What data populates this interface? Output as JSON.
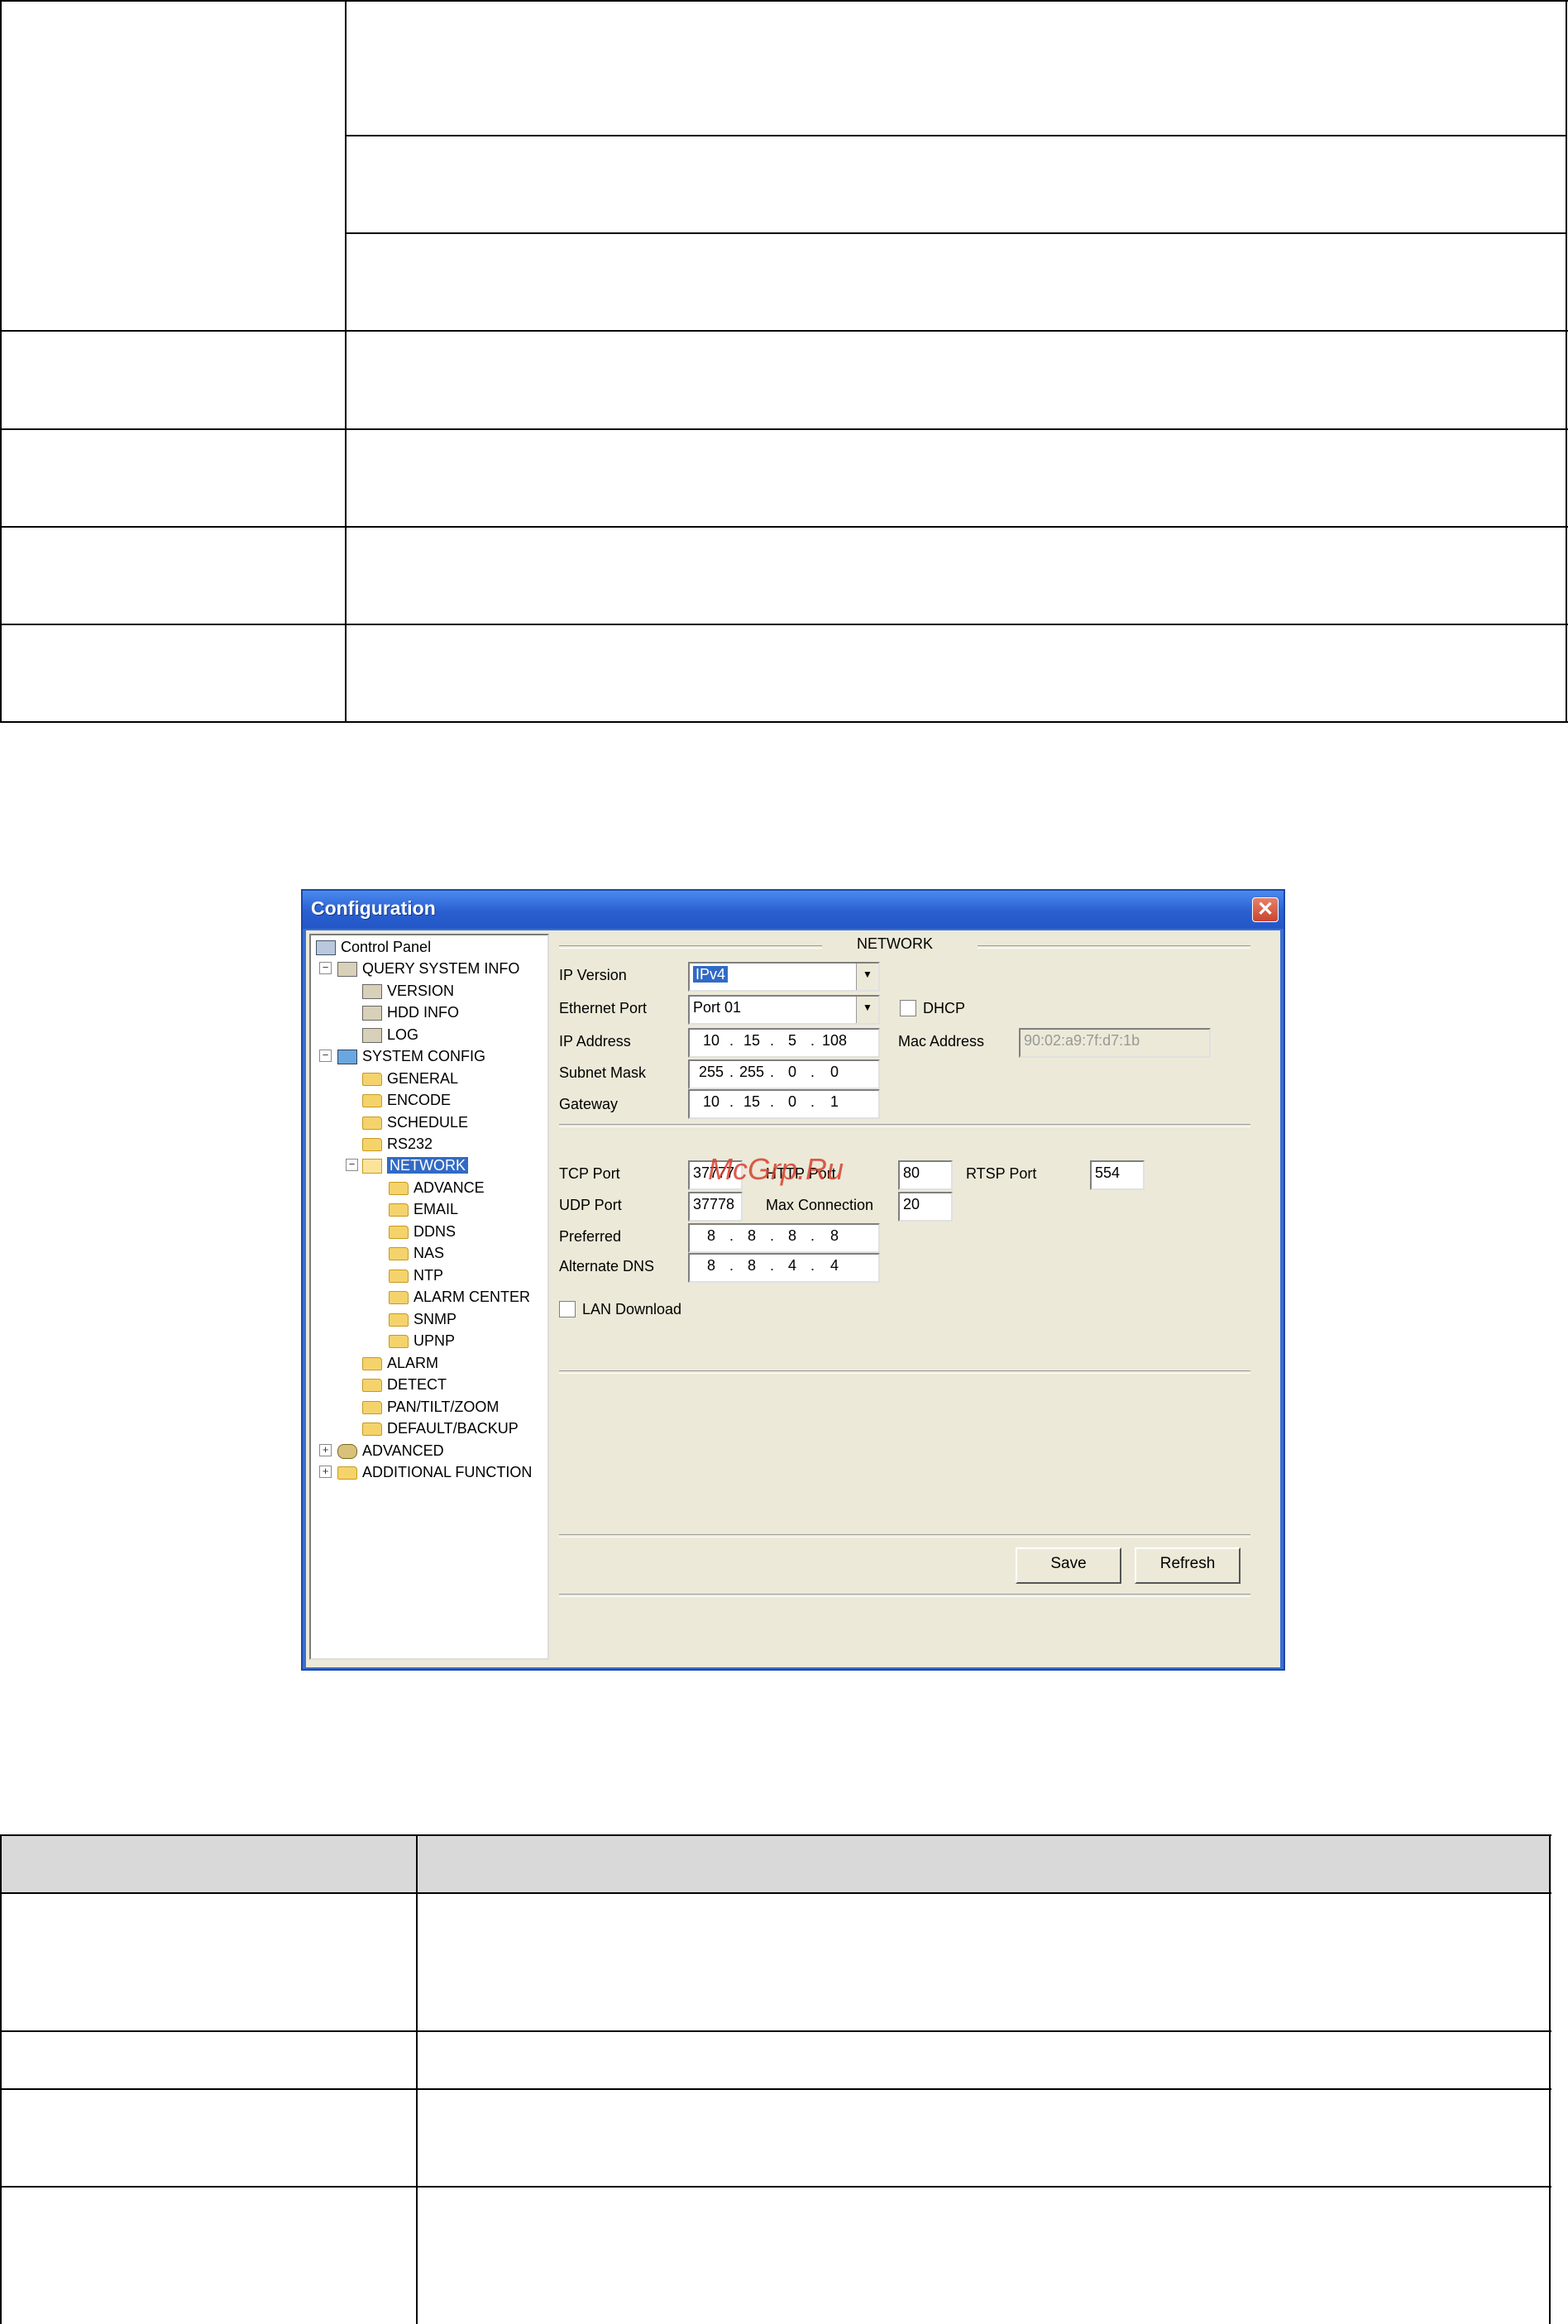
{
  "dialog": {
    "title": "Configuration",
    "tree": {
      "root": "Control Panel",
      "query_system_info": "QUERY SYSTEM INFO",
      "version": "VERSION",
      "hdd_info": "HDD INFO",
      "log": "LOG",
      "system_config": "SYSTEM CONFIG",
      "general": "GENERAL",
      "encode": "ENCODE",
      "schedule": "SCHEDULE",
      "rs232": "RS232",
      "network": "NETWORK",
      "advance": "ADVANCE",
      "email": "EMAIL",
      "ddns": "DDNS",
      "nas": "NAS",
      "ntp": "NTP",
      "alarm_center": "ALARM CENTER",
      "snmp": "SNMP",
      "upnp": "UPNP",
      "alarm": "ALARM",
      "detect": "DETECT",
      "ptz": "PAN/TILT/ZOOM",
      "default_backup": "DEFAULT/BACKUP",
      "advanced": "ADVANCED",
      "additional_function": "ADDITIONAL FUNCTION"
    },
    "network": {
      "heading": "NETWORK",
      "ip_version_label": "IP Version",
      "ip_version_value": "IPv4",
      "ethernet_port_label": "Ethernet Port",
      "ethernet_port_value": "Port 01",
      "dhcp_label": "DHCP",
      "ip_address_label": "IP Address",
      "ip_address": [
        "10",
        "15",
        "5",
        "108"
      ],
      "mac_address_label": "Mac Address",
      "mac_address_value": "90:02:a9:7f:d7:1b",
      "subnet_mask_label": "Subnet Mask",
      "subnet_mask": [
        "255",
        "255",
        "0",
        "0"
      ],
      "gateway_label": "Gateway",
      "gateway": [
        "10",
        "15",
        "0",
        "1"
      ],
      "tcp_port_label": "TCP Port",
      "tcp_port_value": "37777",
      "http_port_label": "HTTP Port",
      "http_port_value": "80",
      "rtsp_port_label": "RTSP Port",
      "rtsp_port_value": "554",
      "udp_port_label": "UDP Port",
      "udp_port_value": "37778",
      "max_connection_label": "Max Connection",
      "max_connection_value": "20",
      "preferred_label": "Preferred",
      "preferred_dns": [
        "8",
        "8",
        "8",
        "8"
      ],
      "alternate_dns_label": "Alternate DNS",
      "alternate_dns": [
        "8",
        "8",
        "4",
        "4"
      ],
      "lan_download_label": "LAN Download",
      "save_label": "Save",
      "refresh_label": "Refresh"
    }
  },
  "watermark": "McGrp.Ru"
}
